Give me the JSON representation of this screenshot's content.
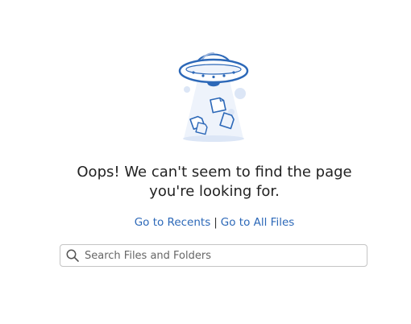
{
  "message": {
    "line1": "Oops! We can't seem to find the page",
    "line2": "you're looking for."
  },
  "links": {
    "recents": "Go to Recents",
    "separator": "|",
    "all_files": "Go to All Files"
  },
  "search": {
    "placeholder": "Search Files and Folders",
    "icon": "search-icon"
  },
  "illustration": {
    "icon": "ufo-icon",
    "accent_color": "#2c68b8",
    "light_color": "#dce6f6"
  }
}
